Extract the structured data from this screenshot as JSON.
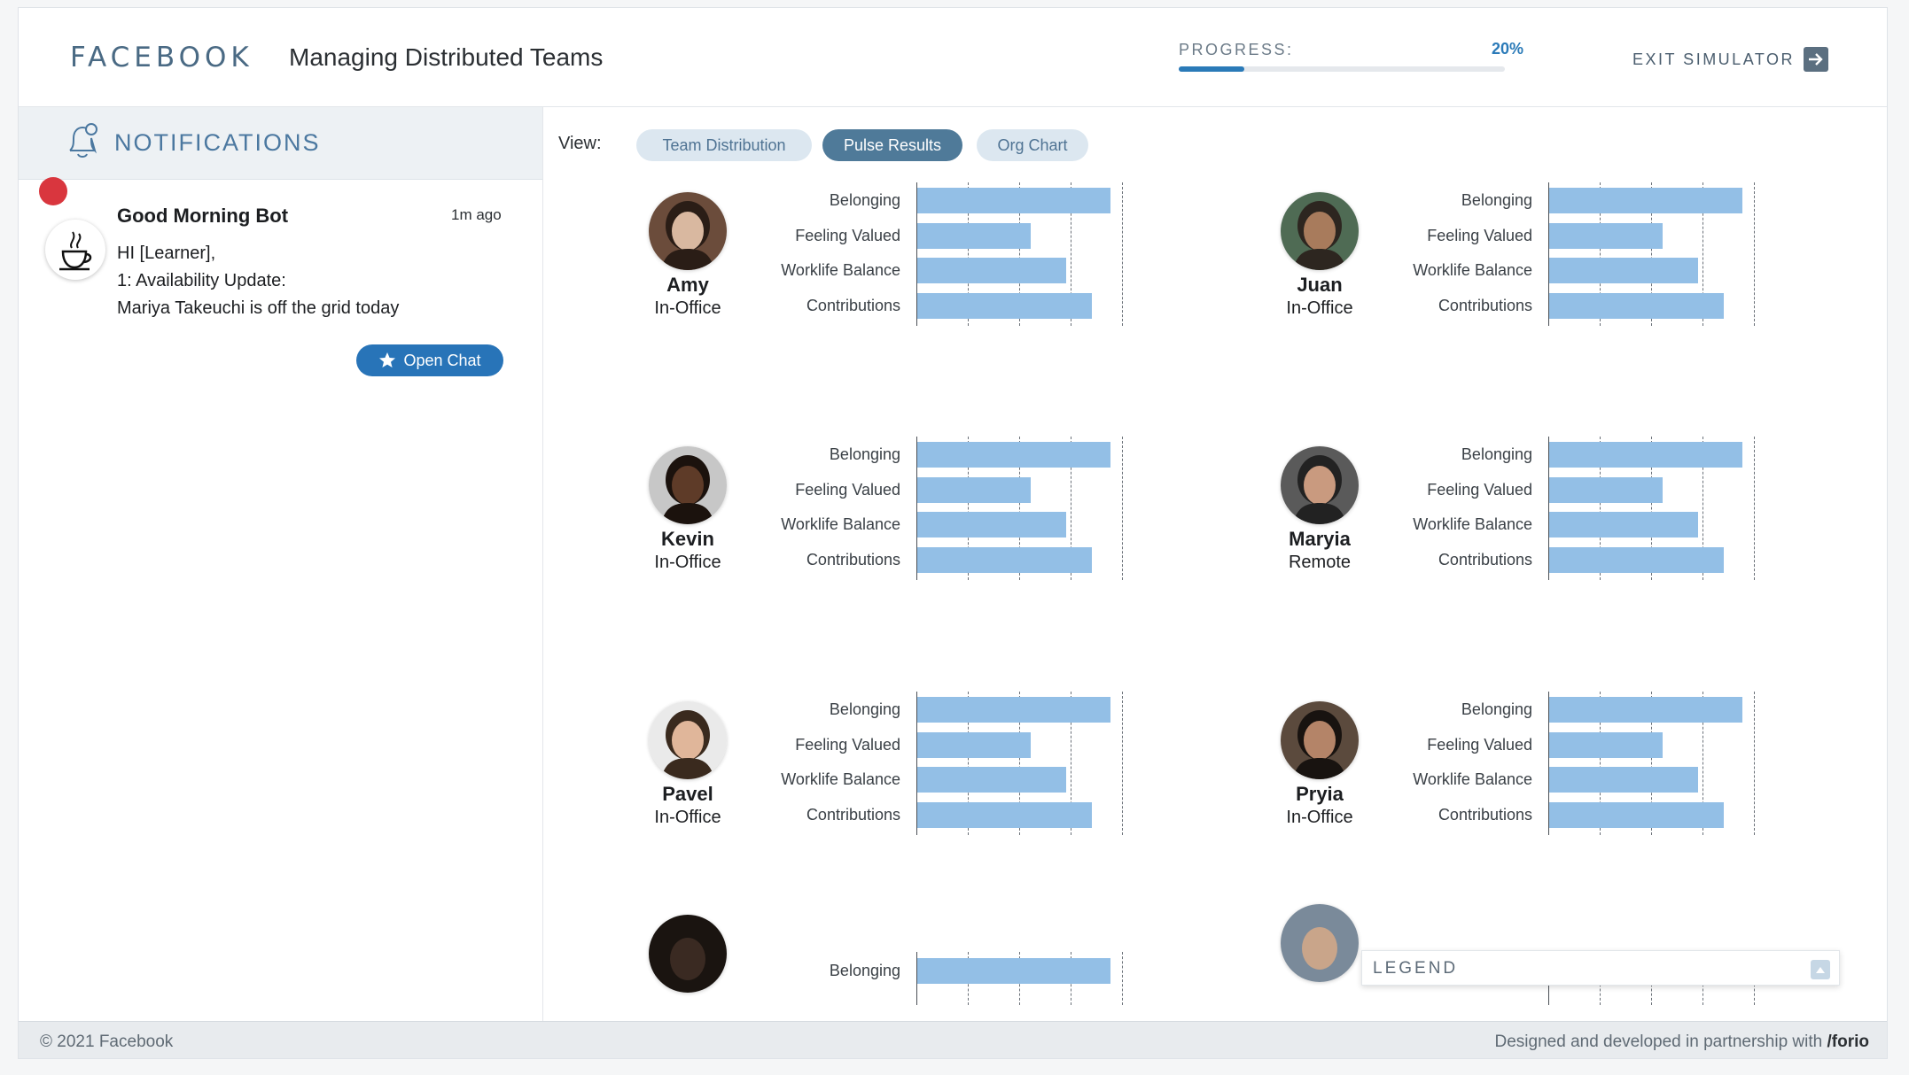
{
  "header": {
    "brand": "FACEBOOK",
    "title": "Managing Distributed Teams",
    "progress_label": "PROGRESS:",
    "progress_value": "20%",
    "progress_fraction": 0.2,
    "exit_label": "EXIT SIMULATOR"
  },
  "sidebar": {
    "title": "NOTIFICATIONS",
    "notification": {
      "sender": "Good Morning Bot",
      "time": "1m ago",
      "line1": "HI [Learner],",
      "line2": "1: Availability Update:",
      "line3": "Mariya  Takeuchi is off the grid today",
      "button": "Open Chat"
    }
  },
  "main": {
    "view_label": "View:",
    "tabs": [
      {
        "label": "Team Distribution",
        "active": false
      },
      {
        "label": "Pulse Results",
        "active": true
      },
      {
        "label": "Org Chart",
        "active": false
      }
    ],
    "metrics": [
      "Belonging",
      "Feeling Valued",
      "Worklife Balance",
      "Contributions"
    ],
    "people": [
      {
        "name": "Amy",
        "location": "In-Office"
      },
      {
        "name": "Juan",
        "location": "In-Office"
      },
      {
        "name": "Kevin",
        "location": "In-Office"
      },
      {
        "name": "Maryia",
        "location": "Remote"
      },
      {
        "name": "Pavel",
        "location": "In-Office"
      },
      {
        "name": "Pryia",
        "location": "In-Office"
      }
    ],
    "partial_metric": "Belonging"
  },
  "chart_data": {
    "type": "bar",
    "orientation": "horizontal",
    "categories": [
      "Belonging",
      "Feeling Valued",
      "Worklife Balance",
      "Contributions"
    ],
    "values": [
      3.75,
      2.2,
      2.9,
      3.4
    ],
    "xlim": [
      0,
      4
    ],
    "grid": true,
    "bar_color": "#93bfe6"
  },
  "legend": {
    "title": "LEGEND"
  },
  "footer": {
    "copyright": "© 2021 Facebook",
    "credit_prefix": "Designed and developed in partnership with",
    "credit_brand": "/forio"
  },
  "colors": {
    "accent": "#2a7ab8",
    "tab_active": "#4f7a99",
    "badge": "#d9363e"
  }
}
